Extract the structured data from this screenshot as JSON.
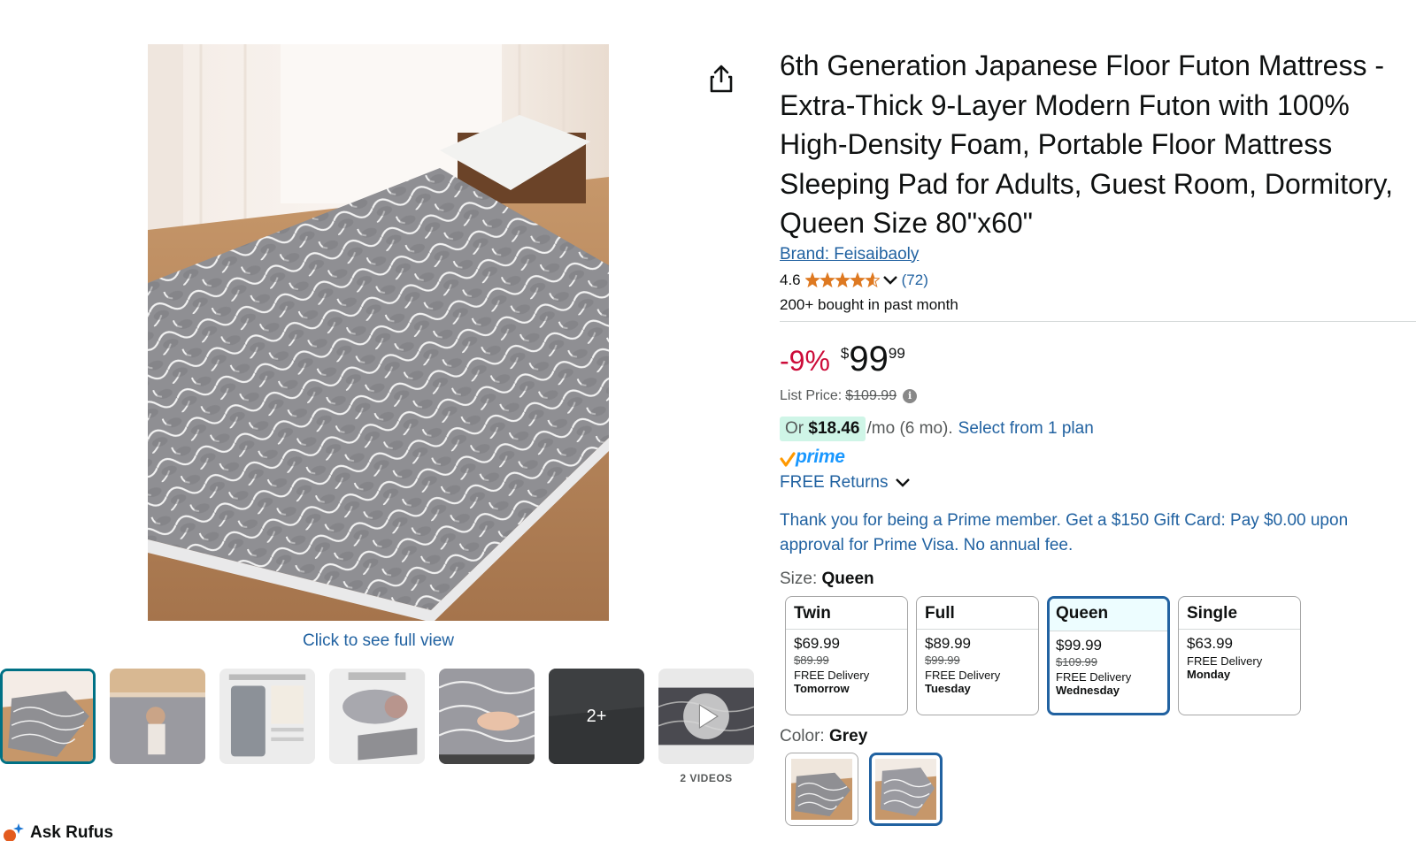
{
  "product": {
    "title": "6th Generation Japanese Floor Futon Mattress - Extra-Thick 9-Layer Modern Futon with 100% High-Density Foam, Portable Floor Mattress Sleeping Pad for Adults, Guest Room, Dormitory, Queen Size 80\"x60\"",
    "brand": "Brand: Feisaibaoly",
    "rating": "4.6",
    "rating_count": "(72)",
    "stars_value": 4.6,
    "bought": "200+ bought in past month"
  },
  "price": {
    "discount": "-9%",
    "currency": "$",
    "whole": "99",
    "fraction": "99",
    "list_label": "List Price:",
    "list_value": "$109.99",
    "info": "i"
  },
  "monthly": {
    "or": "Or",
    "amount": "$18.46",
    "per": "/mo (6 mo).",
    "plan_link": "Select from 1 plan"
  },
  "prime": {
    "label": "prime",
    "check": "✓"
  },
  "returns": {
    "label": "FREE Returns"
  },
  "promo": {
    "text": "Thank you for being a Prime member. Get a $150 Gift Card: Pay $0.00 upon approval for Prime Visa. No annual fee."
  },
  "size": {
    "label": "Size:",
    "selected": "Queen",
    "options": [
      {
        "name": "Twin",
        "price": "$69.99",
        "old": "$89.99",
        "delivery": "FREE Delivery",
        "day": "Tomorrow",
        "selected": false
      },
      {
        "name": "Full",
        "price": "$89.99",
        "old": "$99.99",
        "delivery": "FREE Delivery",
        "day": "Tuesday",
        "selected": false
      },
      {
        "name": "Queen",
        "price": "$99.99",
        "old": "$109.99",
        "delivery": "FREE Delivery",
        "day": "Wednesday",
        "selected": true
      },
      {
        "name": "Single",
        "price": "$63.99",
        "old": "",
        "delivery": "FREE Delivery",
        "day": "Monday",
        "selected": false
      }
    ]
  },
  "color": {
    "label": "Color:",
    "selected": "Grey"
  },
  "gallery": {
    "full_view": "Click to see full view",
    "more_count": "2+",
    "videos_label": "2 VIDEOS"
  },
  "rufus": {
    "label": "Ask Rufus"
  },
  "colors": {
    "link": "#2162a1",
    "deal_red": "#cc0c39",
    "star": "#de7921",
    "selected_border": "#2162a1",
    "prime_blue": "#1a98ff",
    "prime_check": "#ff9900"
  }
}
